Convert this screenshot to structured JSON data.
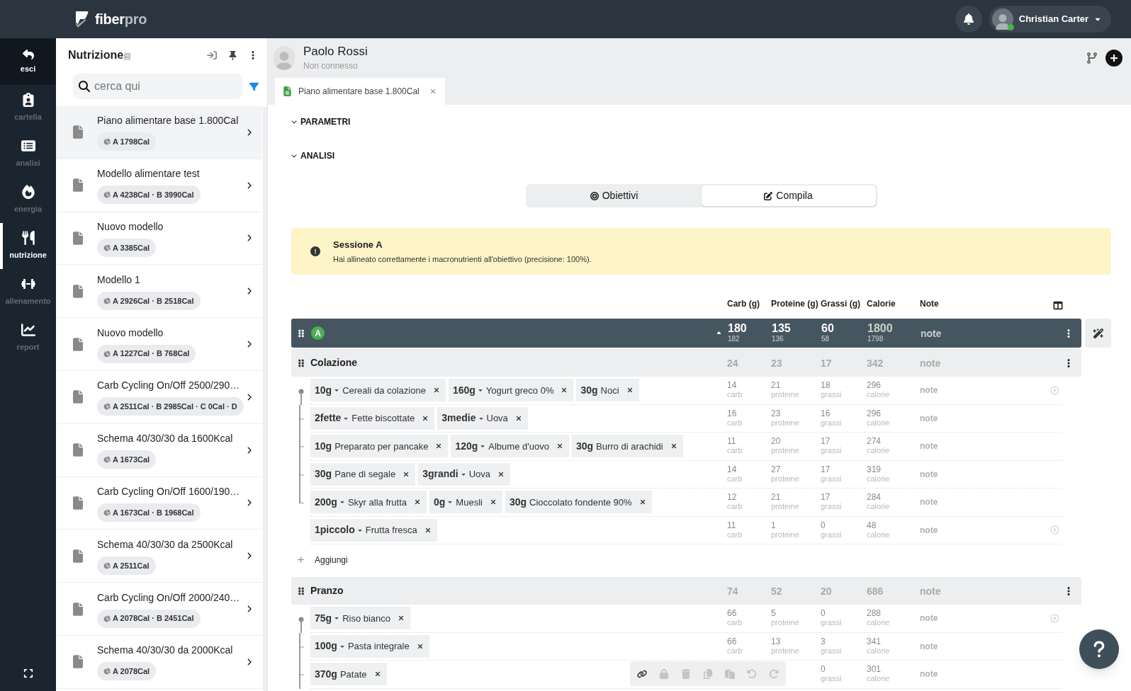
{
  "logo": {
    "primary": "fiber",
    "secondary": "pro"
  },
  "user": {
    "name": "Christian Carter",
    "online": true
  },
  "nav": {
    "exit": {
      "label": "esci"
    },
    "items": [
      {
        "kind": "folder",
        "label": "cartella",
        "selected": false
      },
      {
        "kind": "analysis",
        "label": "analisi",
        "selected": false
      },
      {
        "kind": "energy",
        "label": "energia",
        "selected": false
      },
      {
        "kind": "nutrition",
        "label": "nutrizione",
        "selected": true
      },
      {
        "kind": "training",
        "label": "allenamento",
        "selected": false
      },
      {
        "kind": "report",
        "label": "report",
        "selected": false
      }
    ]
  },
  "sidebar": {
    "title": "Nutrizione",
    "search": {
      "placeholder": "cerca qui"
    },
    "items": [
      {
        "title": "Piano alimentare base 1.800Cal",
        "badge": "A 1798Cal",
        "selected": true
      },
      {
        "title": "Modello alimentare test",
        "badge": "A 4238Cal · B 3990Cal",
        "selected": false
      },
      {
        "title": "Nuovo modello",
        "badge": "A 3385Cal",
        "selected": false
      },
      {
        "title": "Modello 1",
        "badge": "A 2926Cal · B 2518Cal",
        "selected": false
      },
      {
        "title": "Nuovo modello",
        "badge": "A 1227Cal · B 768Cal",
        "selected": false
      },
      {
        "title": "Carb Cycling On/Off 2500/290…",
        "badge": "A 2511Cal · B 2985Cal · C 0Cal · D",
        "selected": false
      },
      {
        "title": "Schema 40/30/30 da 1600Kcal",
        "badge": "A 1673Cal",
        "selected": false
      },
      {
        "title": "Carb Cycling On/Off 1600/190…",
        "badge": "A 1673Cal · B 1968Cal",
        "selected": false
      },
      {
        "title": "Schema 40/30/30 da 2500Kcal",
        "badge": "A 2511Cal",
        "selected": false
      },
      {
        "title": "Carb Cycling On/Off 2000/240…",
        "badge": "A 2078Cal · B 2451Cal",
        "selected": false
      },
      {
        "title": "Schema 40/30/30 da 2000Kcal",
        "badge": "A 2078Cal",
        "selected": false
      }
    ]
  },
  "patient": {
    "name": "Paolo Rossi",
    "status": "Non connesso"
  },
  "tabs": [
    {
      "label": "Piano alimentare base 1.800Cal",
      "selected": true
    }
  ],
  "sections": [
    {
      "label": "PARAMETRI",
      "expanded": true
    },
    {
      "label": "ANALISI",
      "expanded": true
    }
  ],
  "mode_toggle": [
    {
      "kind": "target",
      "label": "Obiettivi",
      "selected": false
    },
    {
      "kind": "edit",
      "label": "Compila",
      "selected": true
    }
  ],
  "alert": {
    "title": "Sessione A",
    "message": "Hai allineato correttamente i macronutrienti all'obiettivo (precisione: 100%)."
  },
  "table": {
    "columns": [
      "Carb (g)",
      "Proteine (g)",
      "Grassi (g)",
      "Calorie",
      "Note"
    ],
    "session": {
      "label": "A",
      "expanded": true,
      "totals": [
        [
          "180",
          "182"
        ],
        [
          "135",
          "136"
        ],
        [
          "60",
          "58"
        ],
        [
          "1800",
          "1798"
        ]
      ],
      "note": "note"
    },
    "meals": [
      {
        "name": "Colazione",
        "totals": [
          "24",
          "23",
          "17",
          "342"
        ],
        "note": "note",
        "add_label": "Aggiungi",
        "rows": [
          {
            "kind": "start",
            "add": true,
            "foods": [
              {
                "amount": "10g",
                "menu": true,
                "food": "Cereali da colazione"
              },
              {
                "amount": "160g",
                "menu": true,
                "food": "Yogurt greco 0%"
              },
              {
                "amount": "30g",
                "menu": false,
                "food": "Noci"
              }
            ],
            "values": [
              [
                "14",
                "carb"
              ],
              [
                "21",
                "proteine"
              ],
              [
                "18",
                "grassi"
              ],
              [
                "296",
                "calorie"
              ]
            ],
            "note": "note"
          },
          {
            "kind": "mid",
            "add": false,
            "foods": [
              {
                "amount": "2fette",
                "menu": true,
                "food": "Fette biscottate"
              },
              {
                "amount": "3medie",
                "menu": true,
                "food": "Uova"
              }
            ],
            "values": [
              [
                "16",
                "carb"
              ],
              [
                "23",
                "proteine"
              ],
              [
                "16",
                "grassi"
              ],
              [
                "296",
                "calorie"
              ]
            ],
            "note": "note"
          },
          {
            "kind": "mid",
            "add": false,
            "foods": [
              {
                "amount": "10g",
                "menu": false,
                "food": "Preparato per pancake"
              },
              {
                "amount": "120g",
                "menu": true,
                "food": "Albume d'uovo"
              },
              {
                "amount": "30g",
                "menu": false,
                "food": "Burro di arachidi"
              }
            ],
            "values": [
              [
                "11",
                "carb"
              ],
              [
                "20",
                "proteine"
              ],
              [
                "17",
                "grassi"
              ],
              [
                "274",
                "calorie"
              ]
            ],
            "note": "note"
          },
          {
            "kind": "mid",
            "add": false,
            "foods": [
              {
                "amount": "30g",
                "menu": false,
                "food": "Pane di segale"
              },
              {
                "amount": "3grandi",
                "menu": true,
                "food": "Uova"
              }
            ],
            "values": [
              [
                "14",
                "carb"
              ],
              [
                "27",
                "proteine"
              ],
              [
                "17",
                "grassi"
              ],
              [
                "319",
                "calorie"
              ]
            ],
            "note": "note"
          },
          {
            "kind": "end",
            "add": false,
            "foods": [
              {
                "amount": "200g",
                "menu": true,
                "food": "Skyr alla frutta"
              },
              {
                "amount": "0g",
                "menu": true,
                "food": "Muesli"
              },
              {
                "amount": "30g",
                "menu": false,
                "food": "Cioccolato fondente 90%"
              }
            ],
            "values": [
              [
                "12",
                "carb"
              ],
              [
                "21",
                "proteine"
              ],
              [
                "17",
                "grassi"
              ],
              [
                "284",
                "calorie"
              ]
            ],
            "note": "note"
          },
          {
            "kind": "none",
            "add": true,
            "foods": [
              {
                "amount": "1piccolo",
                "menu": true,
                "food": "Frutta fresca"
              }
            ],
            "values": [
              [
                "11",
                "carb"
              ],
              [
                "1",
                "proteine"
              ],
              [
                "0",
                "grassi"
              ],
              [
                "48",
                "calorie"
              ]
            ],
            "note": "note"
          }
        ]
      },
      {
        "name": "Pranzo",
        "totals": [
          "74",
          "52",
          "20",
          "686"
        ],
        "note": "note",
        "rows": [
          {
            "kind": "start",
            "add": true,
            "foods": [
              {
                "amount": "75g",
                "menu": true,
                "food": "Riso bianco"
              }
            ],
            "values": [
              [
                "66",
                "carb"
              ],
              [
                "5",
                "proteine"
              ],
              [
                "0",
                "grassi"
              ],
              [
                "288",
                "calorie"
              ]
            ],
            "note": "note"
          },
          {
            "kind": "mid",
            "add": false,
            "foods": [
              {
                "amount": "100g",
                "menu": true,
                "food": "Pasta integrale"
              }
            ],
            "values": [
              [
                "66",
                "carb"
              ],
              [
                "13",
                "proteine"
              ],
              [
                "3",
                "grassi"
              ],
              [
                "341",
                "calorie"
              ]
            ],
            "note": "note"
          },
          {
            "kind": "mid",
            "add": false,
            "foods": [
              {
                "amount": "370g",
                "menu": false,
                "food": "Patate"
              }
            ],
            "values": [
              [
                "0",
                "grassi"
              ],
              [
                "301",
                "calorie"
              ]
            ],
            "note": "note"
          }
        ]
      }
    ]
  },
  "toolbar": [
    {
      "kind": "link",
      "disabled": false
    },
    {
      "kind": "lock",
      "disabled": true
    },
    {
      "kind": "trash",
      "disabled": true
    },
    {
      "kind": "copy",
      "disabled": true
    },
    {
      "kind": "paste",
      "disabled": true
    },
    {
      "kind": "undo",
      "disabled": true
    },
    {
      "kind": "redo",
      "disabled": true
    }
  ]
}
